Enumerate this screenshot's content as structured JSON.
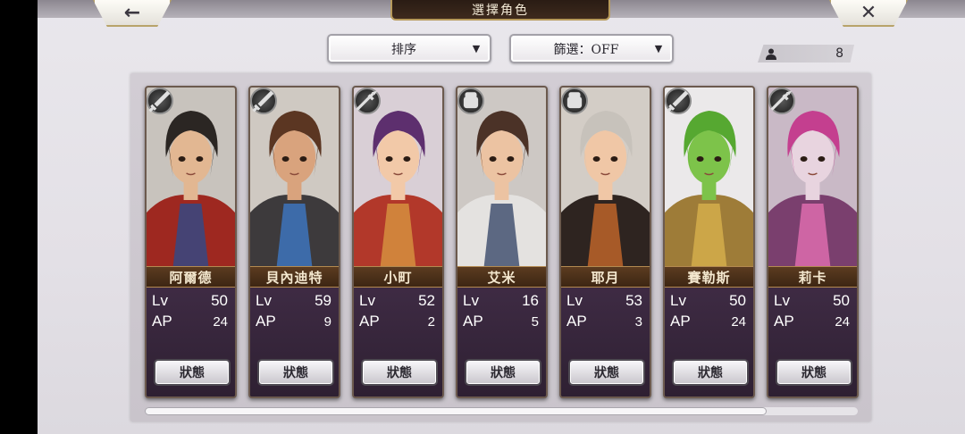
{
  "header": {
    "title": "選擇角色",
    "back_icon": "←",
    "close_icon": "✕"
  },
  "controls": {
    "sort_label": "排序",
    "filter_label": "篩選：OFF",
    "dropdown_arrow": "▼",
    "character_count": "8"
  },
  "labels": {
    "lv": "Lv",
    "ap": "AP",
    "status_button": "狀態"
  },
  "characters": [
    {
      "name": "阿爾德",
      "lv": "50",
      "ap": "24",
      "weapon": "sword",
      "colors": {
        "bg": "#c8c3bd",
        "hair": "#2b2623",
        "skin": "#e2b792",
        "outfit": "#9e2820",
        "accent": "#2e4a8a"
      }
    },
    {
      "name": "貝內迪特",
      "lv": "59",
      "ap": "9",
      "weapon": "sword",
      "colors": {
        "bg": "#cfc9c2",
        "hair": "#5b3622",
        "skin": "#d9a37d",
        "outfit": "#3d3a3c",
        "accent": "#3d78c4"
      }
    },
    {
      "name": "小町",
      "lv": "52",
      "ap": "2",
      "weapon": "spear",
      "colors": {
        "bg": "#d9cfd6",
        "hair": "#5d2f6e",
        "skin": "#f2c9a8",
        "outfit": "#b2382a",
        "accent": "#d79540"
      }
    },
    {
      "name": "艾米",
      "lv": "16",
      "ap": "5",
      "weapon": "fist",
      "colors": {
        "bg": "#cdc8c4",
        "hair": "#4b3227",
        "skin": "#ecc3a2",
        "outfit": "#e4e2e0",
        "accent": "#3a4a6a"
      }
    },
    {
      "name": "耶月",
      "lv": "53",
      "ap": "3",
      "weapon": "fist",
      "colors": {
        "bg": "#d3cdc6",
        "hair": "#c7c2bb",
        "skin": "#f0c7a6",
        "outfit": "#2e2420",
        "accent": "#c6682a"
      }
    },
    {
      "name": "賽勒斯",
      "lv": "50",
      "ap": "24",
      "weapon": "sword",
      "colors": {
        "bg": "#ebe9ea",
        "hair": "#56a831",
        "skin": "#7dc34a",
        "outfit": "#9e7c38",
        "accent": "#d7b04c"
      }
    },
    {
      "name": "莉卡",
      "lv": "50",
      "ap": "24",
      "weapon": "spear",
      "colors": {
        "bg": "#c9b9c6",
        "hair": "#c43f8f",
        "skin": "#e8d4df",
        "outfit": "#7a3f6e",
        "accent": "#e46fb2"
      }
    }
  ]
}
